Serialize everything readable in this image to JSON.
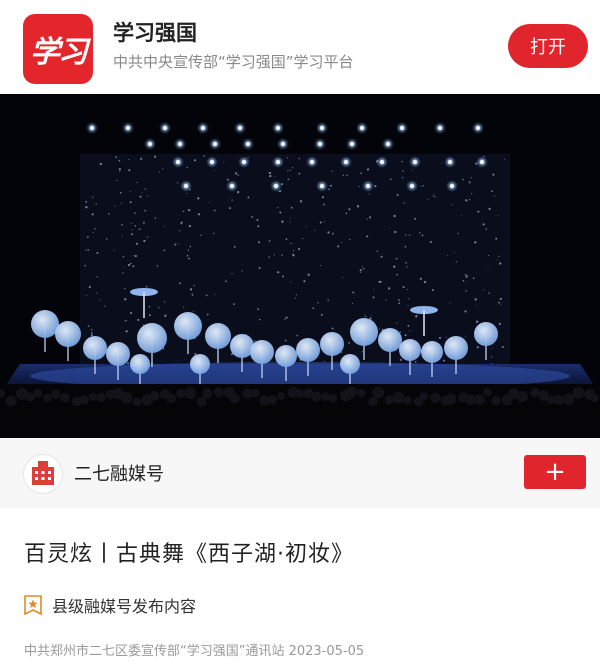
{
  "app": {
    "logo_text": "学习",
    "name": "学习强国",
    "subtitle": "中共中央宣传部“学习强国”学习平台",
    "open_label": "打开"
  },
  "video": {
    "description_icon": "stage-performance-image"
  },
  "channel": {
    "name": "二七融媒号",
    "follow_label": "+"
  },
  "article": {
    "title": "百灵炫丨古典舞《西子湖·初妆》",
    "tag_label": "县级融媒号发布内容",
    "meta": "中共郑州市二七区委宣传部“学习强国”通讯站  2023-05-05"
  },
  "colors": {
    "brand_red": "#e1252c",
    "stage_blue": "#a9c8f0"
  }
}
